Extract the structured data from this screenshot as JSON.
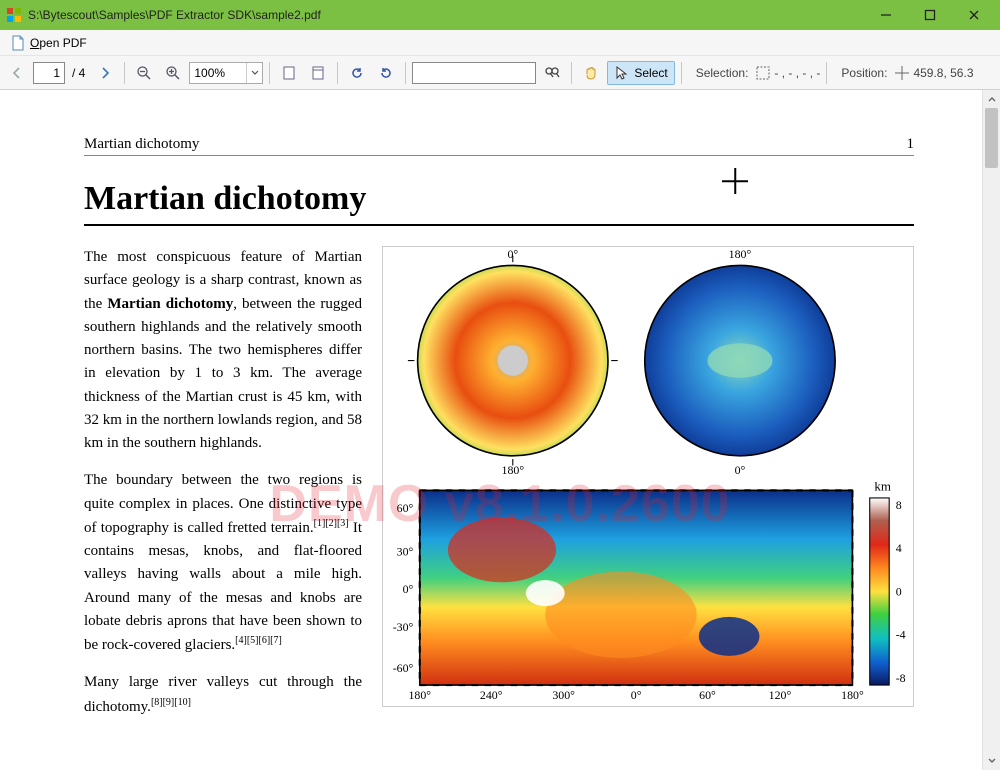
{
  "window": {
    "title": "S:\\Bytescout\\Samples\\PDF Extractor SDK\\sample2.pdf"
  },
  "menu": {
    "open_pdf": "Open PDF",
    "open_mnemonic": "O"
  },
  "toolbar": {
    "page_current": "1",
    "page_total": "/ 4",
    "zoom_value": "100%",
    "select_label": "Select",
    "selection_label": "Selection:",
    "selection_value": "- , - , - , -",
    "position_label": "Position:",
    "position_value": "459.8, 56.3"
  },
  "document": {
    "running_head": "Martian dichotomy",
    "page_number": "1",
    "title": "Martian dichotomy",
    "watermark": "DEMO v8.1.0.2600",
    "para1_a": "The most conspicuous feature of Martian surface geology is a sharp contrast, known as the ",
    "term": "Martian dichotomy",
    "para1_b": ", between the rugged southern highlands and the relatively smooth northern basins. The two hemispheres differ in elevation by 1 to 3 km. The average thickness of the Martian crust is 45 km, with 32 km in the northern lowlands region, and 58 km in the southern highlands.",
    "para2_a": "The boundary between the two regions is quite complex in places. One distinctive type of topography is called fretted terrain.",
    "para2_refs": "[1][2][3]",
    "para2_b": " It contains mesas, knobs, and flat-floored valleys having walls about a mile high. Around many of the mesas and knobs are lobate debris aprons that have been shown to be rock-covered glaciers.",
    "para2_refs2": "[4][5][6][7]",
    "para3_a": "Many large river valleys cut through the dichotomy.",
    "para3_refs": "[8][9][10]"
  },
  "figure": {
    "polar_north_label": "0°",
    "polar_north_opp": "180°",
    "polar_south_label": "180°",
    "polar_south_opp": "0°",
    "map_xticks": [
      "180°",
      "240°",
      "300°",
      "0°",
      "60°",
      "120°",
      "180°"
    ],
    "map_yticks": [
      "60°",
      "30°",
      "0°",
      "-30°",
      "-60°"
    ],
    "colorbar_label": "km",
    "colorbar_ticks": [
      "8",
      "4",
      "0",
      "-4",
      "-8"
    ]
  }
}
